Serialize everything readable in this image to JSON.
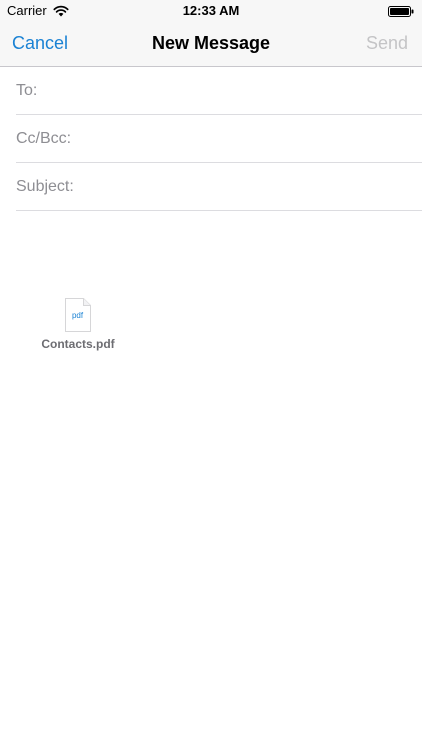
{
  "status_bar": {
    "carrier": "Carrier",
    "time": "12:33 AM",
    "wifi_icon": "wifi-icon",
    "battery_icon": "battery-icon"
  },
  "nav": {
    "cancel_label": "Cancel",
    "title": "New Message",
    "send_label": "Send"
  },
  "fields": {
    "to_label": "To:",
    "cc_bcc_label": "Cc/Bcc:",
    "subject_label": "Subject:"
  },
  "attachment": {
    "icon_text": "pdf",
    "file_name": "Contacts.pdf",
    "icon": "pdf-document-icon"
  },
  "colors": {
    "accent": "#1a82d4",
    "disabled": "#c4c4c6",
    "placeholder": "#8e8e93",
    "bar_background": "#f7f7f7"
  }
}
